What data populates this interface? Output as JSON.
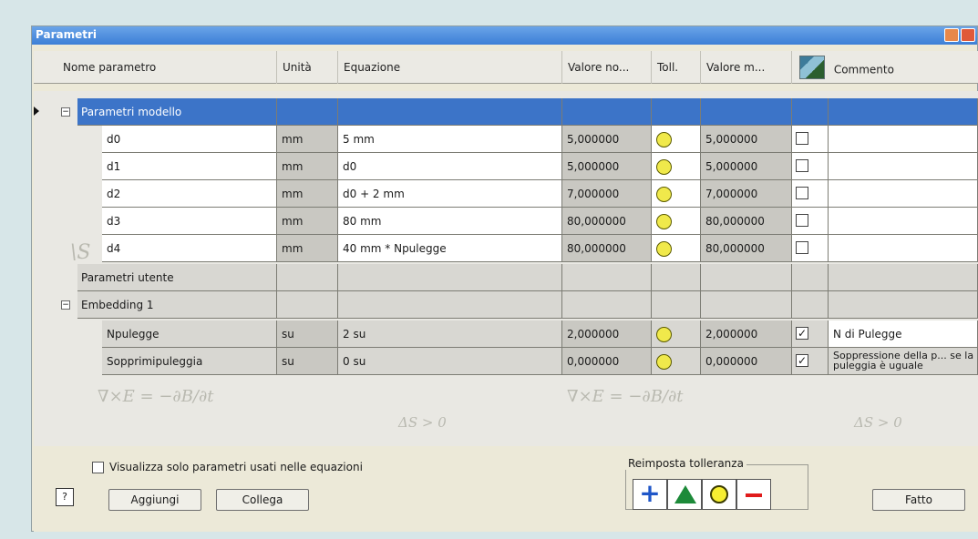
{
  "window": {
    "title": "Parametri"
  },
  "columns": {
    "name": "Nome parametro",
    "unit": "Unità",
    "equation": "Equazione",
    "nominal": "Valore no...",
    "tol": "Toll.",
    "model": "Valore m...",
    "comment": "Commento"
  },
  "groups": {
    "model": "Parametri modello",
    "user": "Parametri utente",
    "embedding": "Embedding 1"
  },
  "rows": [
    {
      "name": "d0",
      "unit": "mm",
      "equation": "5 mm",
      "nominal": "5,000000",
      "model": "5,000000",
      "checked": false,
      "comment": ""
    },
    {
      "name": "d1",
      "unit": "mm",
      "equation": "d0",
      "nominal": "5,000000",
      "model": "5,000000",
      "checked": false,
      "comment": ""
    },
    {
      "name": "d2",
      "unit": "mm",
      "equation": "d0 + 2 mm",
      "nominal": "7,000000",
      "model": "7,000000",
      "checked": false,
      "comment": ""
    },
    {
      "name": "d3",
      "unit": "mm",
      "equation": "80 mm",
      "nominal": "80,000000",
      "model": "80,000000",
      "checked": false,
      "comment": ""
    },
    {
      "name": "d4",
      "unit": "mm",
      "equation": "40 mm * Npulegge",
      "nominal": "80,000000",
      "model": "80,000000",
      "checked": false,
      "comment": ""
    }
  ],
  "embedding_rows": [
    {
      "name": "Npulegge",
      "unit": "su",
      "equation": "2 su",
      "nominal": "2,000000",
      "model": "2,000000",
      "checked": true,
      "comment": "N di Pulegge"
    },
    {
      "name": "Sopprimipuleggia",
      "unit": "su",
      "equation": "0 su",
      "nominal": "0,000000",
      "model": "0,000000",
      "checked": true,
      "comment": "Soppressione della p... se la puleggia è uguale"
    }
  ],
  "bottom": {
    "filter_checkbox_label": "Visualizza solo parametri usati nelle equazioni",
    "help_label": "?",
    "add_label": "Aggiungi",
    "link_label": "Collega",
    "tolerance_group_label": "Reimposta tolleranza",
    "done_label": "Fatto"
  }
}
